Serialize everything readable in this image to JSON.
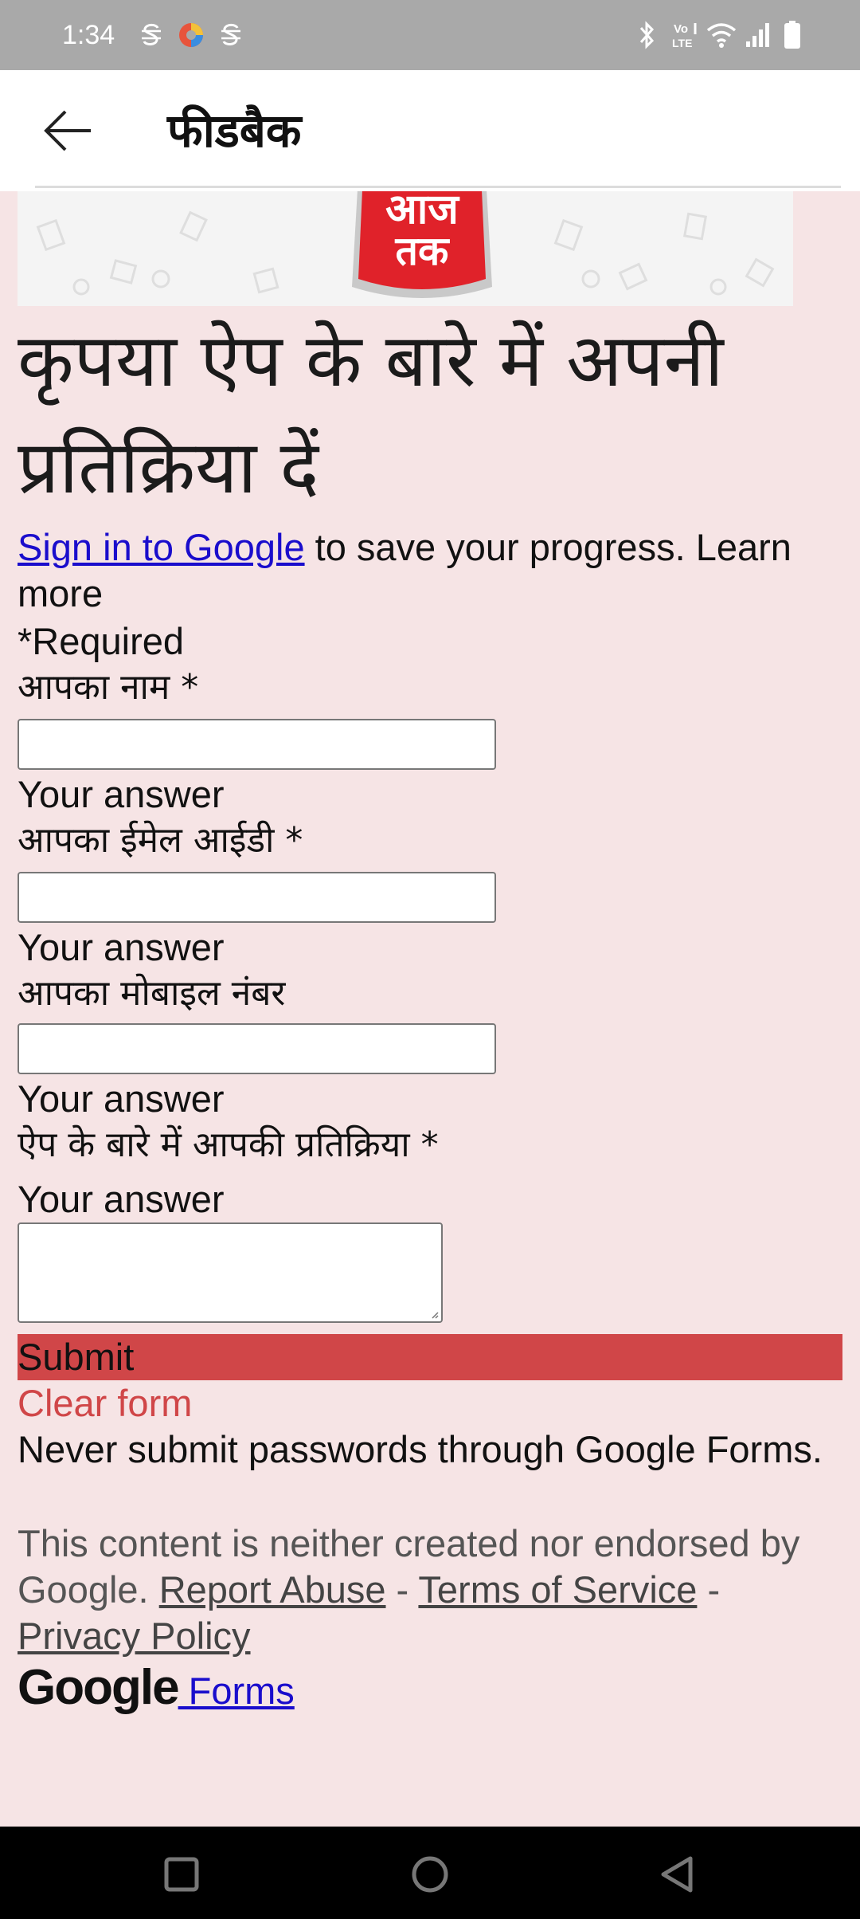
{
  "status_bar": {
    "time": "1:34",
    "left_icons": [
      "s-notification-icon",
      "browser-icon",
      "s-notification-icon"
    ],
    "right_icons": [
      "bluetooth-icon",
      "volte-icon",
      "wifi-icon",
      "signal-icon",
      "battery-icon"
    ],
    "volte_label_top": "Vo",
    "volte_label_bottom": "LTE"
  },
  "app_bar": {
    "title": "फीडबैक"
  },
  "banner": {
    "logo_text_top": "आज",
    "logo_text_bottom": "तक"
  },
  "form": {
    "heading": "कृपया ऐप के बारे में अपनी प्रतिक्रिया दें",
    "sign_in_link": "Sign in to Google",
    "sign_in_rest": " to save your progress. Learn more",
    "required_note": "*Required",
    "fields": [
      {
        "label": "आपका नाम *",
        "hint": "Your answer"
      },
      {
        "label": "आपका ईमेल आईडी *",
        "hint": "Your answer"
      },
      {
        "label": "आपका मोबाइल नंबर",
        "hint": "Your answer"
      },
      {
        "label": "ऐप के बारे में आपकी प्रतिक्रिया *",
        "hint": "Your answer"
      }
    ],
    "submit_label": "Submit",
    "clear_label": "Clear form",
    "password_warning": "Never submit passwords through Google Forms.",
    "disclaimer_prefix": "This content is neither created nor endorsed by Google. ",
    "report_abuse": "Report Abuse",
    "separator": " - ",
    "terms": "Terms of Service",
    "privacy": "Privacy Policy",
    "google_word": "Google",
    "forms_link": " Forms"
  },
  "colors": {
    "page_background": "#f6e4e5",
    "submit_background": "#d04648",
    "link": "#1a0dcc"
  }
}
